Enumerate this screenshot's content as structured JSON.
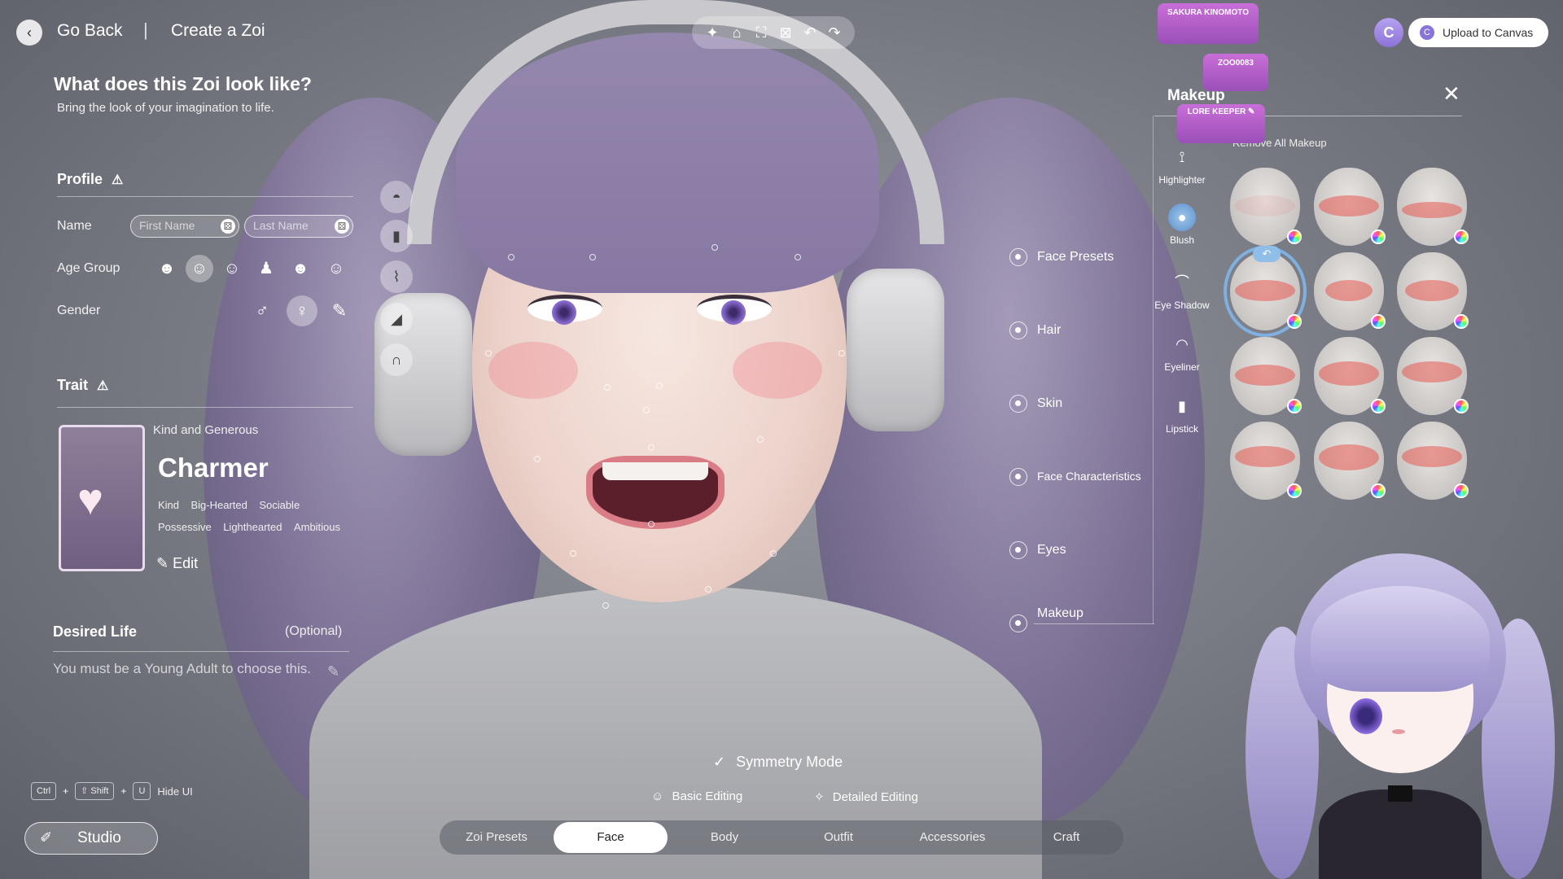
{
  "header": {
    "back_label": "Go Back",
    "title": "Create a Zoi"
  },
  "toolbar": {
    "icons": [
      "sparkle-icon",
      "camera-icon",
      "focus-icon",
      "capture-icon",
      "undo-icon",
      "redo-icon"
    ]
  },
  "left": {
    "heading": "What does this Zoi look like?",
    "subheading": "Bring the look of your imagination to life.",
    "profile": {
      "title": "Profile",
      "name_label": "Name",
      "first_placeholder": "First Name",
      "last_placeholder": "Last Name",
      "age_label": "Age Group",
      "gender_label": "Gender"
    },
    "trait": {
      "title": "Trait",
      "subtitle": "Kind and Generous",
      "name": "Charmer",
      "tags_row1": [
        "Kind",
        "Big-Hearted",
        "Sociable"
      ],
      "tags_row2": [
        "Possessive",
        "Lighthearted",
        "Ambitious"
      ],
      "edit_label": "Edit"
    },
    "desired": {
      "title": "Desired Life",
      "optional": "(Optional)",
      "text": "You must be a Young Adult to choose this."
    },
    "hint": {
      "key1": "Ctrl",
      "plus": "+",
      "key2": "⇧ Shift",
      "key3": "U",
      "label": "Hide UI"
    },
    "studio_label": "Studio"
  },
  "categories": [
    "Face Presets",
    "Hair",
    "Skin",
    "Face Characteristics",
    "Eyes",
    "Makeup"
  ],
  "makeup": {
    "title": "Makeup",
    "remove_all": "Remove All Makeup",
    "cats": [
      "Highlighter",
      "Blush",
      "Eye Shadow",
      "Eyeliner",
      "Lipstick"
    ]
  },
  "stickers": {
    "s1": "SAKURA KINOMOTO",
    "s2": "ZOO0083",
    "s3": "LORE KEEPER ✎"
  },
  "upload_label": "Upload to Canvas",
  "c_badge": "C",
  "bottom": {
    "symmetry": "Symmetry Mode",
    "basic": "Basic Editing",
    "detailed": "Detailed Editing",
    "tabs": [
      "Zoi Presets",
      "Face",
      "Body",
      "Outfit",
      "Accessories",
      "Craft"
    ]
  }
}
